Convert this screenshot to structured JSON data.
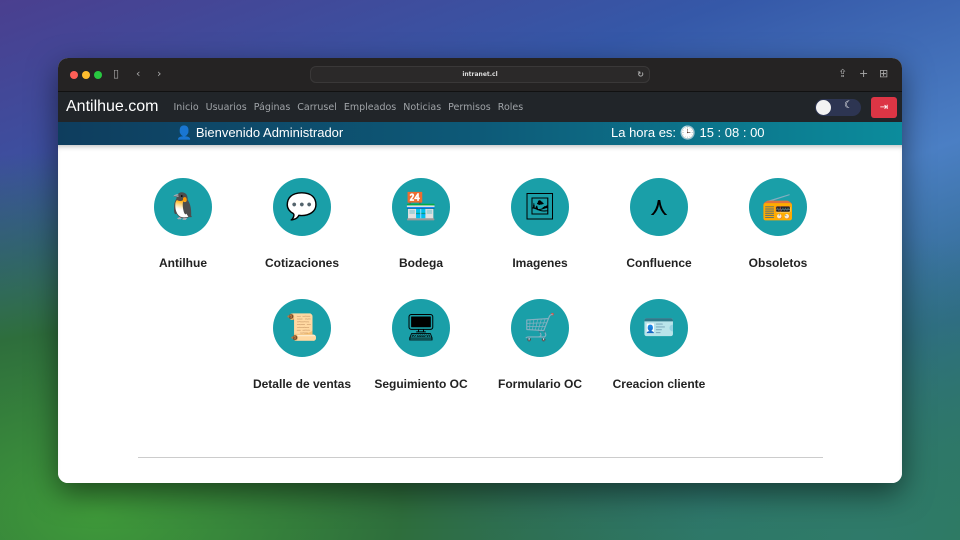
{
  "browser": {
    "url": "intranet.cl"
  },
  "navbar": {
    "brand": "Antilhue.com",
    "links": [
      "Inicio",
      "Usuarios",
      "Páginas",
      "Carrusel",
      "Empleados",
      "Noticias",
      "Permisos",
      "Roles"
    ]
  },
  "banner": {
    "welcome": "Bienvenido Administrador",
    "time_label": "La hora es:",
    "time": "15 : 08 : 00"
  },
  "apps": [
    {
      "label": "Antilhue",
      "icon": "🐧"
    },
    {
      "label": "Cotizaciones",
      "icon": "💬"
    },
    {
      "label": "Bodega",
      "icon": "🏪"
    },
    {
      "label": "Imagenes",
      "icon": "🖼"
    },
    {
      "label": "Confluence",
      "icon": "⋏"
    },
    {
      "label": "Obsoletos",
      "icon": "📻"
    },
    {
      "label": "Detalle de ventas",
      "icon": "📜"
    },
    {
      "label": "Seguimiento OC",
      "icon": "🖥"
    },
    {
      "label": "Formulario OC",
      "icon": "🛒"
    },
    {
      "label": "Creacion cliente",
      "icon": "🪪"
    }
  ],
  "colors": {
    "accent": "#1a9fa8",
    "logout": "#dc3545",
    "navbar": "#212529"
  }
}
